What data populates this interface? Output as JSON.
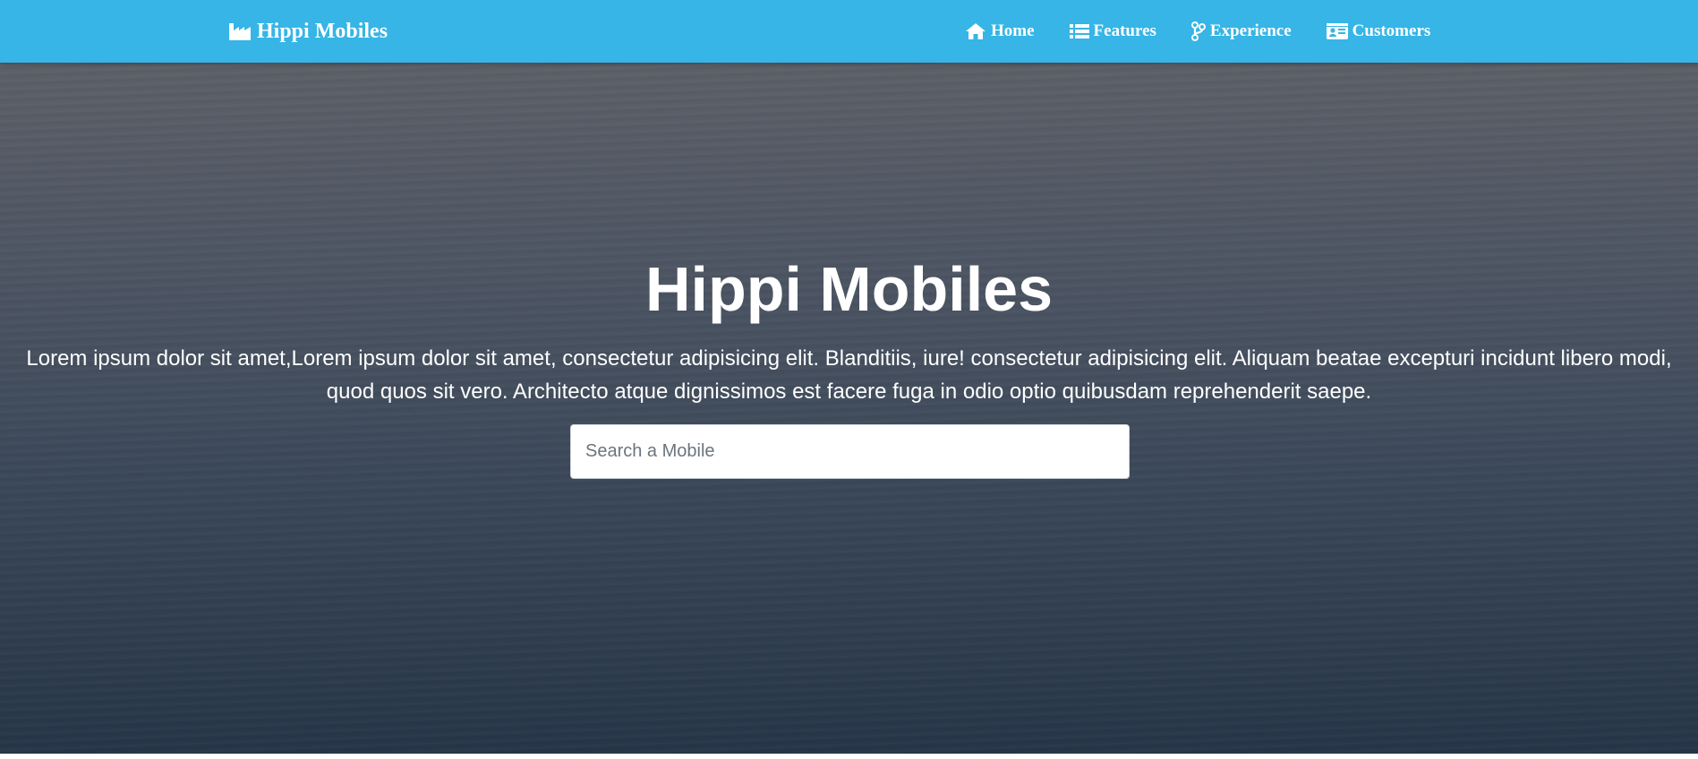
{
  "navbar": {
    "brand": {
      "label": "Hippi Mobiles",
      "icon": "industry-icon"
    },
    "links": [
      {
        "label": "Home",
        "icon": "home-icon"
      },
      {
        "label": "Features",
        "icon": "list-icon"
      },
      {
        "label": "Experience",
        "icon": "code-branch-icon"
      },
      {
        "label": "Customers",
        "icon": "id-card-icon"
      }
    ]
  },
  "hero": {
    "title": "Hippi Mobiles",
    "text": "Lorem ipsum dolor sit amet,Lorem ipsum dolor sit amet, consectetur adipisicing elit. Blanditiis, iure! consectetur adipisicing elit. Aliquam beatae excepturi incidunt libero modi, quod quos sit vero. Architecto atque dignissimos est facere fuga in odio optio quibusdam reprehenderit saepe.",
    "search": {
      "placeholder": "Search a Mobile",
      "value": ""
    }
  },
  "colors": {
    "navbar": "#36b5e6",
    "text": "#ffffff"
  }
}
